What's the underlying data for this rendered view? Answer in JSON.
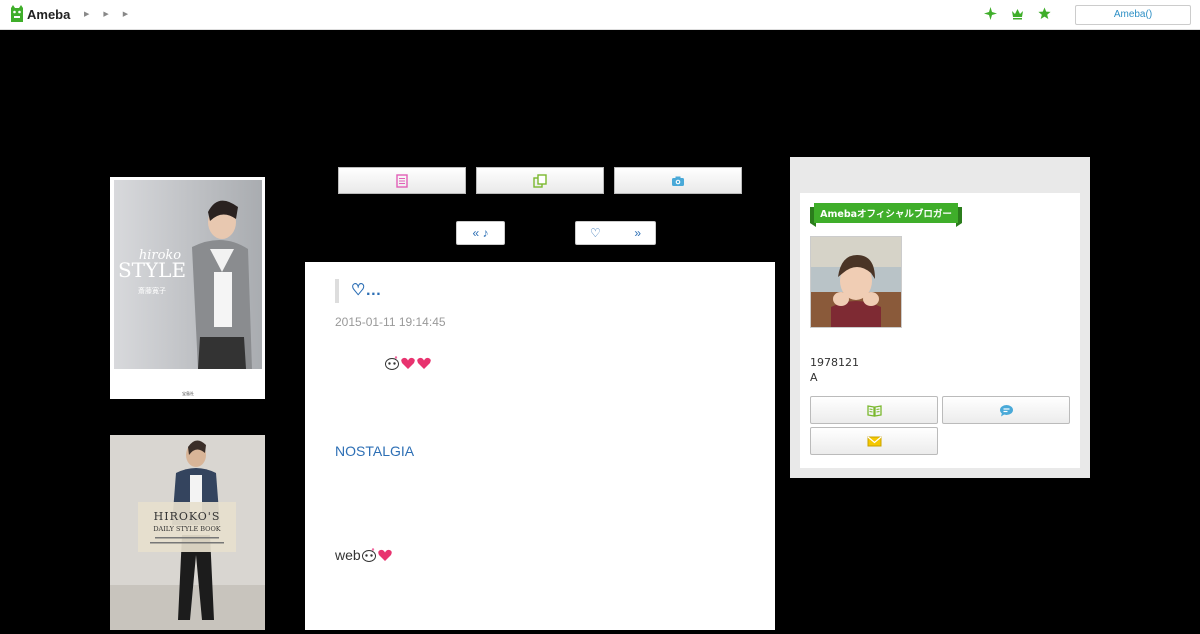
{
  "topbar": {
    "logo_text": "Ameba",
    "breadcrumb_count": 3,
    "login_label": "Ameba()",
    "icons": [
      "sparkle-icon",
      "crown-icon",
      "star-icon"
    ],
    "accent_color": "#3fae2a"
  },
  "books": [
    {
      "title_top": "hiroko",
      "title_main": "STYLE",
      "author": "斎藤寛子",
      "publisher": "宝島社"
    },
    {
      "title_main": "HIROKO'S",
      "subtitle": "DAILY STYLE BOOK"
    }
  ],
  "tabs": [
    {
      "name": "entry-list",
      "icon": "document-icon",
      "color": "#e25fb7"
    },
    {
      "name": "theme-list",
      "icon": "copy-icon",
      "color": "#7ab82e"
    },
    {
      "name": "image-list",
      "icon": "camera-icon",
      "color": "#49a9d8"
    }
  ],
  "pager": {
    "prev_label": "« ♪",
    "next_left": "♡",
    "next_right": "»"
  },
  "article": {
    "title": "♡…",
    "date": "2015-01-11 19:14:45",
    "link_text": "NOSTALGIA",
    "body_text": "web"
  },
  "sidebar": {
    "badge_text": "Amebaオフィシャルブロガー",
    "line1": "1978121",
    "line2": "A",
    "buttons": [
      {
        "icon": "book-icon",
        "color": "#7ab82e"
      },
      {
        "icon": "chat-icon",
        "color": "#49a9d8"
      },
      {
        "icon": "mail-icon",
        "color": "#e6b800"
      }
    ]
  }
}
